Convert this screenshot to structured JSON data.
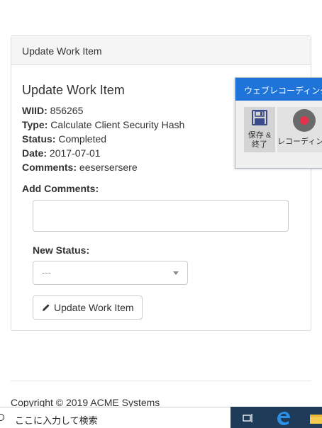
{
  "panel": {
    "heading": "Update Work Item"
  },
  "form": {
    "title": "Update Work Item",
    "wiid_label": "WIID:",
    "wiid_value": "856265",
    "type_label": "Type:",
    "type_value": "Calculate Client Security Hash",
    "status_label": "Status:",
    "status_value": "Completed",
    "date_label": "Date:",
    "date_value": "2017-07-01",
    "comments_label": "Comments:",
    "comments_value": "eesersersere",
    "add_comments_label": "Add Comments:",
    "add_comments_value": "",
    "new_status_label": "New Status:",
    "new_status_selected": "---",
    "update_button_label": "Update Work Item"
  },
  "footer": {
    "copyright": "Copyright © 2019 ACME Systems"
  },
  "recorder": {
    "title": "ウェブレコーディング",
    "save_label_line1": "保存 &",
    "save_label_line2": "終了",
    "record_label": "レコーディング",
    "icons": {
      "save": "floppy-disk-icon",
      "record": "record-icon"
    },
    "colors": {
      "title_bg": "#1e74d8",
      "record_dot": "#e8304a"
    }
  },
  "taskbar": {
    "search_placeholder": "ここに入力して検索",
    "icons": [
      "search-icon",
      "task-view-icon",
      "edge-icon",
      "file-explorer-icon"
    ]
  }
}
